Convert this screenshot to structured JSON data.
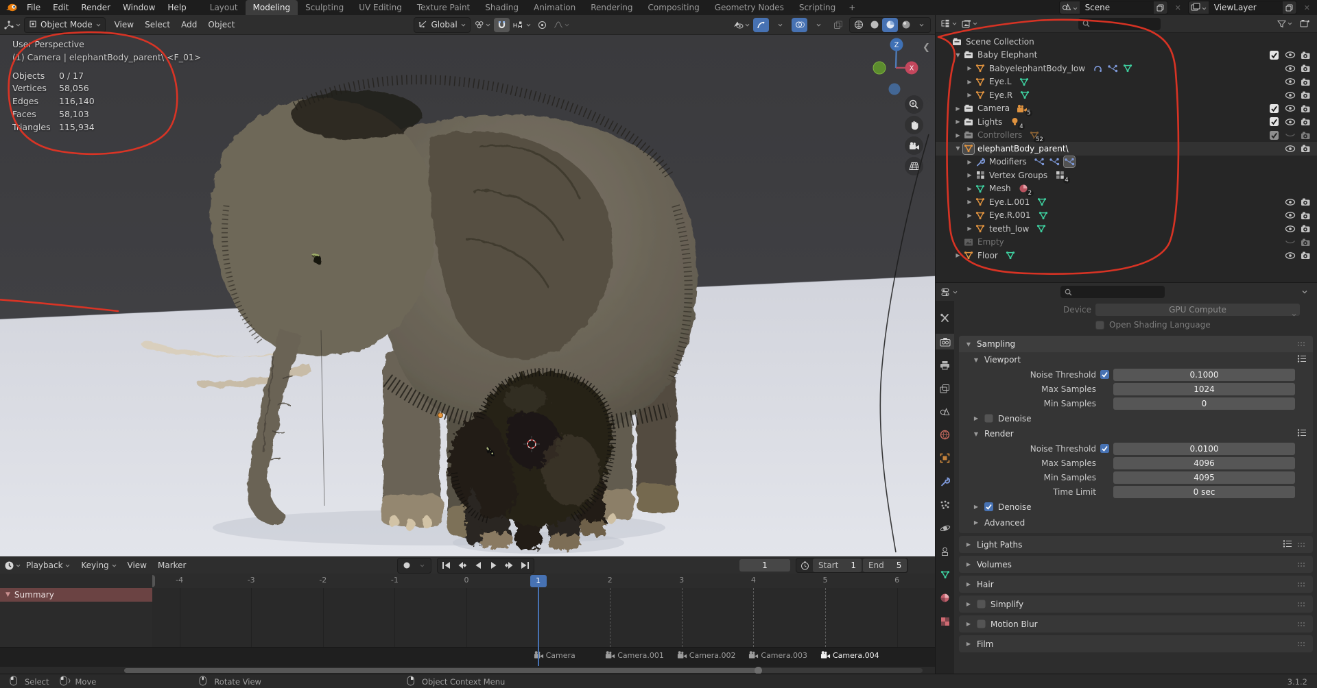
{
  "topbar": {
    "app_menus": [
      "File",
      "Edit",
      "Render",
      "Window",
      "Help"
    ],
    "workspaces": [
      "Layout",
      "Modeling",
      "Sculpting",
      "UV Editing",
      "Texture Paint",
      "Shading",
      "Animation",
      "Rendering",
      "Compositing",
      "Geometry Nodes",
      "Scripting"
    ],
    "active_workspace": "Modeling",
    "new_workspace_button": "+",
    "scene": {
      "value": "Scene"
    },
    "view_layer": {
      "value": "ViewLayer"
    }
  },
  "viewport": {
    "header": {
      "mode": "Object Mode",
      "menus": [
        "View",
        "Select",
        "Add",
        "Object"
      ],
      "orientation": "Global"
    },
    "overlay": {
      "view_label": "User Perspective",
      "context": "(1) Camera | elephantBody_parent\\ <F_01>",
      "stats": [
        {
          "label": "Objects",
          "value": "0 / 17"
        },
        {
          "label": "Vertices",
          "value": "58,056"
        },
        {
          "label": "Edges",
          "value": "116,140"
        },
        {
          "label": "Faces",
          "value": "58,103"
        },
        {
          "label": "Triangles",
          "value": "115,934"
        }
      ]
    },
    "gizmo": {
      "axis_z": "Z",
      "axis_x": "X"
    }
  },
  "outliner": {
    "items": [
      {
        "label": "Scene Collection",
        "level": 0,
        "expand": "none",
        "icon": "collection",
        "toggles": []
      },
      {
        "label": "Baby Elephant",
        "level": 1,
        "expand": "open",
        "icon": "collection",
        "toggles": [
          "check",
          "eye",
          "cam"
        ]
      },
      {
        "label": "BabyelephantBody_low",
        "level": 2,
        "expand": "closed",
        "icon": "mesh-object",
        "extras": [
          {
            "icon": "physics"
          },
          {
            "icon": "particles"
          },
          {
            "icon": "mesh-data"
          }
        ],
        "toggles": [
          "eye",
          "cam"
        ]
      },
      {
        "label": "Eye.L",
        "level": 2,
        "expand": "closed",
        "icon": "mesh-object",
        "extras": [
          {
            "icon": "mesh-data"
          }
        ],
        "toggles": [
          "eye",
          "cam"
        ]
      },
      {
        "label": "Eye.R",
        "level": 2,
        "expand": "closed",
        "icon": "mesh-object",
        "extras": [
          {
            "icon": "mesh-data"
          }
        ],
        "toggles": [
          "eye",
          "cam"
        ]
      },
      {
        "label": "Camera",
        "level": 1,
        "expand": "closed",
        "icon": "collection",
        "extras": [
          {
            "icon": "camera-data",
            "badge": "5"
          }
        ],
        "toggles": [
          "check",
          "eye",
          "cam"
        ]
      },
      {
        "label": "Lights",
        "level": 1,
        "expand": "closed",
        "icon": "collection",
        "extras": [
          {
            "icon": "light-data",
            "badge": "4"
          }
        ],
        "toggles": [
          "check",
          "eye",
          "cam"
        ]
      },
      {
        "label": "Controllers",
        "level": 1,
        "expand": "closed",
        "icon": "collection",
        "muted": true,
        "extras": [
          {
            "icon": "mesh-object",
            "badge": "52"
          }
        ],
        "toggles": [
          "check",
          "eye-closed",
          "cam"
        ]
      },
      {
        "label": "elephantBody_parent\\",
        "level": 1,
        "expand": "open",
        "icon": "mesh-object",
        "active": true,
        "toggles": [
          "eye",
          "cam"
        ]
      },
      {
        "label": "Modifiers",
        "level": 2,
        "expand": "closed",
        "icon": "wrench",
        "extras": [
          {
            "icon": "particles"
          },
          {
            "icon": "particles"
          },
          {
            "icon": "particles-sel"
          }
        ],
        "toggles": []
      },
      {
        "label": "Vertex Groups",
        "level": 2,
        "expand": "closed",
        "icon": "vgroup",
        "extras": [
          {
            "icon": "vgroup-box",
            "badge": "4"
          }
        ],
        "toggles": []
      },
      {
        "label": "Mesh",
        "level": 2,
        "expand": "closed",
        "icon": "mesh-data",
        "extras": [
          {
            "icon": "material",
            "badge": "2"
          }
        ],
        "toggles": []
      },
      {
        "label": "Eye.L.001",
        "level": 2,
        "expand": "closed",
        "icon": "mesh-object",
        "extras": [
          {
            "icon": "mesh-data"
          }
        ],
        "toggles": [
          "eye",
          "cam"
        ]
      },
      {
        "label": "Eye.R.001",
        "level": 2,
        "expand": "closed",
        "icon": "mesh-object",
        "extras": [
          {
            "icon": "mesh-data"
          }
        ],
        "toggles": [
          "eye",
          "cam"
        ]
      },
      {
        "label": "teeth_low",
        "level": 2,
        "expand": "closed",
        "icon": "mesh-object",
        "extras": [
          {
            "icon": "mesh-data"
          }
        ],
        "toggles": [
          "eye",
          "cam"
        ]
      },
      {
        "label": "Empty",
        "level": 1,
        "expand": "none",
        "icon": "image",
        "muted": true,
        "toggles": [
          "eye-closed",
          "cam"
        ]
      },
      {
        "label": "Floor",
        "level": 1,
        "expand": "closed",
        "icon": "mesh-object",
        "extras": [
          {
            "icon": "mesh-data"
          }
        ],
        "toggles": [
          "eye",
          "cam"
        ]
      }
    ]
  },
  "properties": {
    "tabs": [
      {
        "icon": "tool"
      },
      {
        "icon": "render",
        "active": true
      },
      {
        "icon": "output"
      },
      {
        "icon": "view-layer"
      },
      {
        "icon": "scene"
      },
      {
        "icon": "world"
      },
      {
        "icon": "object"
      },
      {
        "icon": "modifiers"
      },
      {
        "icon": "particles"
      },
      {
        "icon": "physics"
      },
      {
        "icon": "constraints"
      },
      {
        "icon": "data"
      },
      {
        "icon": "material"
      },
      {
        "icon": "texture"
      }
    ],
    "device": {
      "label": "Device",
      "value": "GPU Compute"
    },
    "osl_label": "Open Shading Language",
    "sampling": {
      "title": "Sampling",
      "viewport": {
        "title": "Viewport",
        "noise_threshold": {
          "label": "Noise Threshold",
          "value": "0.1000",
          "checked": true
        },
        "max_samples": {
          "label": "Max Samples",
          "value": "1024"
        },
        "min_samples": {
          "label": "Min Samples",
          "value": "0"
        },
        "denoise": {
          "label": "Denoise",
          "checked": false
        }
      },
      "render": {
        "title": "Render",
        "noise_threshold": {
          "label": "Noise Threshold",
          "value": "0.0100",
          "checked": true
        },
        "max_samples": {
          "label": "Max Samples",
          "value": "4096"
        },
        "min_samples": {
          "label": "Min Samples",
          "value": "4095"
        },
        "time_limit": {
          "label": "Time Limit",
          "value": "0 sec"
        },
        "denoise": {
          "label": "Denoise",
          "checked": true
        },
        "advanced_label": "Advanced"
      }
    },
    "collapsed_sections": [
      {
        "label": "Light Paths",
        "has_list_icon": true
      },
      {
        "label": "Volumes"
      },
      {
        "label": "Hair"
      },
      {
        "label": "Simplify",
        "checkbox": false
      },
      {
        "label": "Motion Blur",
        "checkbox": false
      },
      {
        "label": "Film"
      }
    ]
  },
  "timeline": {
    "menus": [
      "Playback",
      "Keying",
      "View",
      "Marker"
    ],
    "summary_label": "Summary",
    "current_frame": "1",
    "start": {
      "label": "Start",
      "value": "1"
    },
    "end": {
      "label": "End",
      "value": "5"
    },
    "ruler_ticks": [
      -4,
      -3,
      -2,
      -1,
      0,
      1,
      2,
      3,
      4,
      5,
      6
    ],
    "markers": [
      {
        "label": "Camera",
        "frame": 1
      },
      {
        "label": "Camera.001",
        "frame": 2
      },
      {
        "label": "Camera.002",
        "frame": 3
      },
      {
        "label": "Camera.003",
        "frame": 4
      },
      {
        "label": "Camera.004",
        "frame": 5,
        "selected": true
      }
    ]
  },
  "status_bar": {
    "hints": [
      {
        "button": "left",
        "label": "Select"
      },
      {
        "button": "left-drag",
        "label": "Move"
      },
      {
        "button": "middle",
        "label": "Rotate View"
      },
      {
        "button": "right",
        "label": "Object Context Menu"
      }
    ],
    "version": "3.1.2"
  },
  "colors": {
    "accent": "#4772b3",
    "object_orange": "#e0933f",
    "mesh_green": "#3ecf9f",
    "annotation_red": "#e23424"
  }
}
